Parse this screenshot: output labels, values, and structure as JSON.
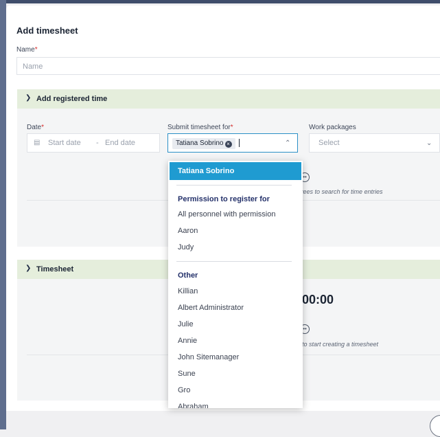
{
  "form": {
    "title": "Add timesheet",
    "name_label": "Name",
    "required_mark": "*",
    "name_placeholder": "Name"
  },
  "registered_section": {
    "title": "Add registered time",
    "date_label": "Date",
    "start_placeholder": "Start date",
    "date_separator": "-",
    "end_placeholder": "End date",
    "submit_label": "Submit timesheet for",
    "selected_person": "Tatiana Sobrino",
    "work_packages_label": "Work packages",
    "work_packages_placeholder": "Select",
    "hint_text": "yees to search for time entries"
  },
  "timesheet_section": {
    "title": "Timesheet",
    "total_time": "00:00",
    "hint_text": "to start creating a timesheet"
  },
  "dropdown": {
    "selected": "Tatiana Sobrino",
    "group1_title": "Permission to register for",
    "group1_items": [
      "All personnel with permission",
      "Aaron",
      "Judy"
    ],
    "group2_title": "Other",
    "group2_items": [
      "Killian",
      "Albert Administrator",
      "Julie",
      "Annie",
      "John Sitemanager",
      "Sune",
      "Gro",
      "Abraham"
    ]
  },
  "icons": {
    "section_toggle": "chevron-down-icon",
    "calendar": "calendar-icon",
    "chip_remove": "close-circle-icon",
    "dropdown_toggle": "chevron-up-icon",
    "select_toggle": "chevron-down-icon",
    "empty_state": "smiley-icon"
  },
  "colors": {
    "section_header": "#e5eedc",
    "dropdown_highlight": "#1f9bd1",
    "required": "#d62b2b",
    "frame": "#5f6e8e"
  }
}
